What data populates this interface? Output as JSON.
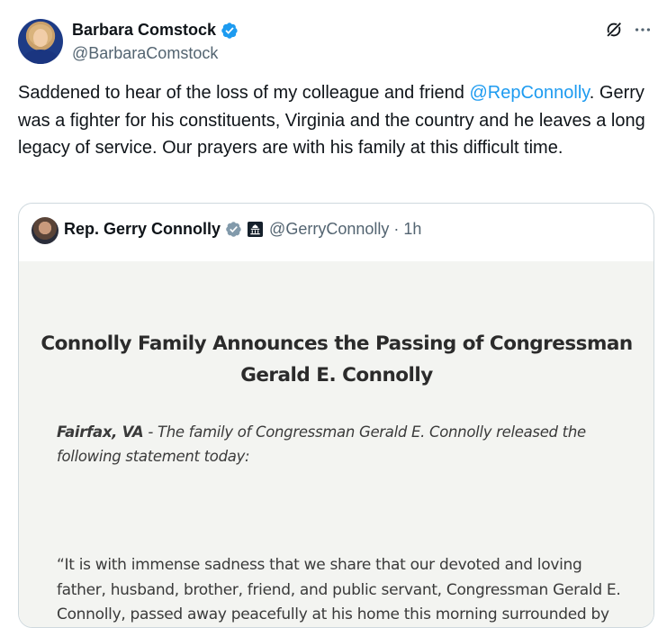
{
  "author": {
    "display_name": "Barbara Comstock",
    "handle": "@BarbaraComstock"
  },
  "tweet": {
    "text_before": "Saddened to hear of the loss of my colleague and friend ",
    "mention": "@RepConnolly",
    "text_after": ". Gerry was a fighter for his constituents, Virginia and the country and he leaves a long legacy of service. Our prayers are with his family at this difficult time."
  },
  "quoted": {
    "display_name": "Rep. Gerry Connolly",
    "handle_time": "@GerryConnolly · 1h",
    "statement": {
      "title": "Connolly Family Announces the Passing of Congressman Gerald E. Connolly",
      "dateline": "Fairfax, VA",
      "lead": " - The family of Congressman Gerald E. Connolly released the following statement today:",
      "body": "“It is with immense sadness that we share that our devoted and loving father, husband, brother, friend, and public servant, Congressman Gerald E. Connolly, passed away peacefully at his home this morning surrounded by family."
    }
  },
  "icons": {
    "verified": "verified-badge-icon",
    "grok": "grok-icon",
    "more": "more-options-icon",
    "affiliation": "capitol-affiliation-icon"
  },
  "colors": {
    "verified_blue": "#1d9bf0",
    "verified_gray": "#829aab",
    "mention_blue": "#1d9bf0",
    "secondary_text": "#536471"
  }
}
